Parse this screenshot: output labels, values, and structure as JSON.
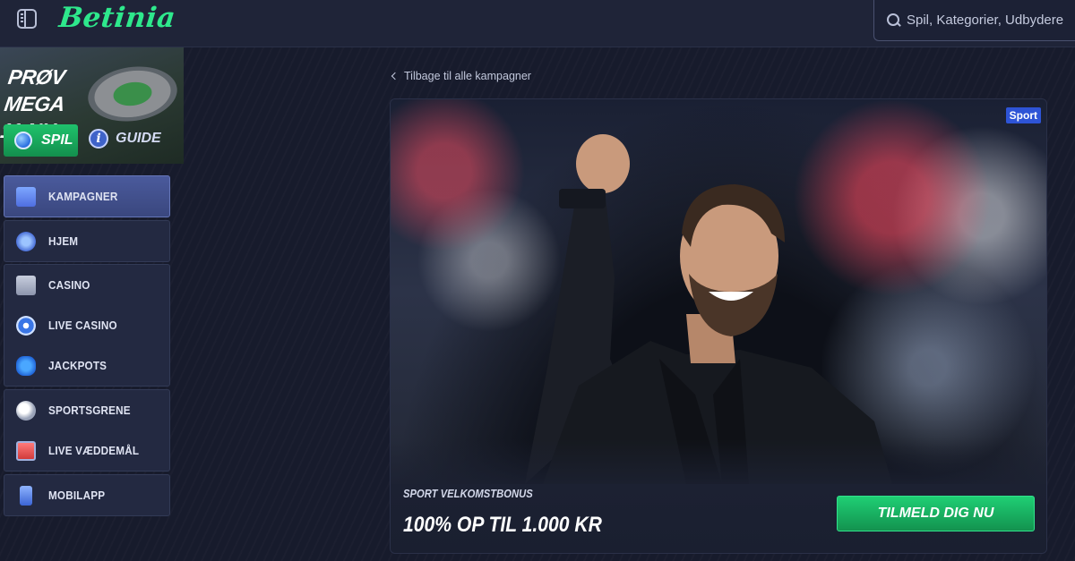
{
  "header": {
    "logo": "Betinia",
    "search_placeholder": "Spil, Kategorier, Udbydere"
  },
  "sidebar": {
    "promo": {
      "title_line1": "PRØV MEGA",
      "title_line2": "11 NU",
      "play_label": "SPIL",
      "guide_label": "GUIDE"
    },
    "items": [
      {
        "label": "KAMPAGNER",
        "icon": "gift-icon",
        "active": true
      },
      {
        "label": "HJEM",
        "icon": "home-icon"
      },
      {
        "label": "CASINO",
        "icon": "slot-machine-icon"
      },
      {
        "label": "LIVE CASINO",
        "icon": "casino-chip-icon"
      },
      {
        "label": "JACKPOTS",
        "icon": "clover-icon"
      },
      {
        "label": "SPORTSGRENE",
        "icon": "soccer-ball-icon"
      },
      {
        "label": "LIVE VÆDDEMÅL",
        "icon": "live-tv-icon"
      },
      {
        "label": "MOBILAPP",
        "icon": "phone-icon"
      }
    ]
  },
  "main": {
    "back_link": "Tilbage til alle kampagner",
    "card": {
      "badge": "Sport",
      "kicker": "SPORT VELKOMSTBONUS",
      "headline": "100% OP TIL 1.000 KR",
      "cta": "TILMELD DIG NU"
    }
  },
  "colors": {
    "brand_green": "#2ee88c",
    "cta_green": "#1fcf74",
    "active_nav": "#4a5a9c",
    "badge_blue": "#2e54d6",
    "background": "#171b2c"
  }
}
